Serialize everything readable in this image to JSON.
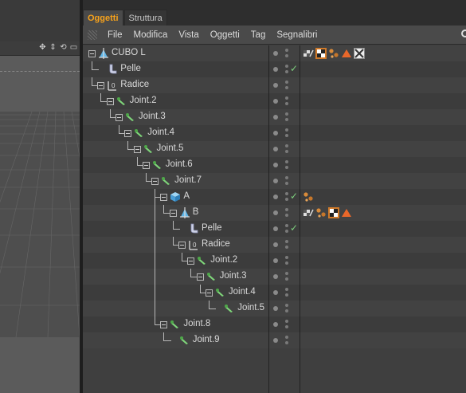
{
  "tabs": [
    {
      "label": "Oggetti",
      "active": true
    },
    {
      "label": "Struttura",
      "active": false
    }
  ],
  "menu": [
    "File",
    "Modifica",
    "Vista",
    "Oggetti",
    "Tag",
    "Segnalibri"
  ],
  "objects": [
    {
      "label": "CUBO L",
      "depth": 0,
      "icon": "null-icon",
      "expander": true,
      "check": false,
      "tags": [
        "texture-tag-icon",
        "checker-material-icon",
        "dots-material-icon",
        "orange-triangle-icon",
        "xpresso-tag-icon"
      ]
    },
    {
      "label": "Pelle",
      "depth": 1,
      "icon": "skin-deformer-icon",
      "expander": false,
      "check": true,
      "tags": []
    },
    {
      "label": "Radice",
      "depth": 1,
      "icon": "joint-root-icon",
      "expander": true,
      "check": false,
      "tags": []
    },
    {
      "label": "Joint.2",
      "depth": 2,
      "icon": "joint-icon",
      "expander": true,
      "check": false,
      "tags": []
    },
    {
      "label": "Joint.3",
      "depth": 3,
      "icon": "joint-icon",
      "expander": true,
      "check": false,
      "tags": []
    },
    {
      "label": "Joint.4",
      "depth": 4,
      "icon": "joint-icon",
      "expander": true,
      "check": false,
      "tags": []
    },
    {
      "label": "Joint.5",
      "depth": 5,
      "icon": "joint-icon",
      "expander": true,
      "check": false,
      "tags": []
    },
    {
      "label": "Joint.6",
      "depth": 6,
      "icon": "joint-icon",
      "expander": true,
      "check": false,
      "tags": []
    },
    {
      "label": "Joint.7",
      "depth": 7,
      "icon": "joint-icon",
      "expander": true,
      "check": false,
      "tags": []
    },
    {
      "label": "A",
      "depth": 8,
      "icon": "cube-icon",
      "expander": true,
      "check": true,
      "tags": [
        "dots-material-icon"
      ]
    },
    {
      "label": "B",
      "depth": 9,
      "icon": "null-icon",
      "expander": true,
      "check": false,
      "tags": [
        "texture-tag-icon",
        "dots-material-icon",
        "checker-material-icon",
        "orange-triangle-icon"
      ]
    },
    {
      "label": "Pelle",
      "depth": 10,
      "icon": "skin-deformer-icon",
      "expander": false,
      "check": true,
      "tags": []
    },
    {
      "label": "Radice",
      "depth": 10,
      "icon": "joint-root-icon",
      "expander": true,
      "check": false,
      "tags": []
    },
    {
      "label": "Joint.2",
      "depth": 11,
      "icon": "joint-icon",
      "expander": true,
      "check": false,
      "tags": []
    },
    {
      "label": "Joint.3",
      "depth": 12,
      "icon": "joint-icon",
      "expander": true,
      "check": false,
      "tags": []
    },
    {
      "label": "Joint.4",
      "depth": 13,
      "icon": "joint-icon",
      "expander": true,
      "check": false,
      "tags": []
    },
    {
      "label": "Joint.5",
      "depth": 14,
      "icon": "joint-icon",
      "expander": false,
      "check": false,
      "tags": []
    },
    {
      "label": "Joint.8",
      "depth": 8,
      "icon": "joint-icon",
      "expander": true,
      "check": false,
      "tags": []
    },
    {
      "label": "Joint.9",
      "depth": 9,
      "icon": "joint-icon",
      "expander": false,
      "check": false,
      "tags": []
    }
  ],
  "colors": {
    "accent": "#f7a21b",
    "check": "#7ed07e",
    "joint": "#7fd67a",
    "cube": "#5fb6e8",
    "triangle": "#e8672a"
  }
}
